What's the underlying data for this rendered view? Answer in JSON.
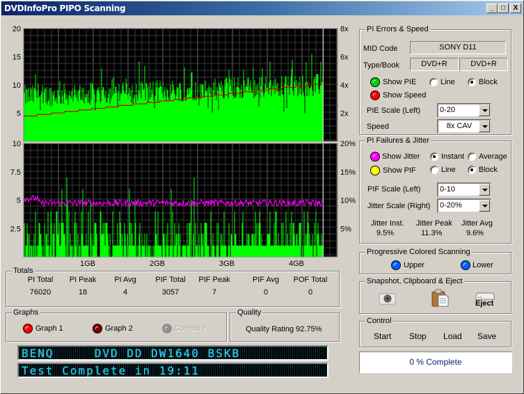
{
  "window": {
    "title": "DVDInfoPro PIPO Scanning",
    "buttons": {
      "minimize": "_",
      "maximize": "□",
      "close": "X"
    }
  },
  "chart_data": [
    {
      "type": "bar",
      "title": "PI Errors & Speed",
      "xlabel": "",
      "ylabel": "PIE",
      "x_ticks": [
        "1GB",
        "2GB",
        "3GB",
        "4GB"
      ],
      "xlim_gb": [
        0,
        4.58
      ],
      "ylim": [
        0,
        20
      ],
      "y_ticks_left": [
        "20",
        "15",
        "10",
        "5"
      ],
      "y2_ticks": [
        "8x",
        "6x",
        "4x",
        "2x"
      ],
      "y2lim": [
        0,
        8
      ],
      "grid": true,
      "scan_end_gb": 4.37,
      "series": [
        {
          "name": "PIE",
          "color": "#00ff00",
          "kind": "block",
          "typical": 9,
          "peak": 18,
          "avg": 4
        },
        {
          "name": "Speed",
          "color": "#cc0000",
          "kind": "line",
          "start": 1.8,
          "end": 4.15
        }
      ]
    },
    {
      "type": "bar",
      "title": "PI Failures & Jitter",
      "x_ticks": [
        "1GB",
        "2GB",
        "3GB",
        "4GB"
      ],
      "xlim_gb": [
        0,
        4.58
      ],
      "ylim": [
        0,
        10
      ],
      "y_ticks_left": [
        "10",
        "7.5",
        "5",
        "2.5"
      ],
      "y2_ticks": [
        "20%",
        "15%",
        "10%",
        "5%"
      ],
      "y2lim": [
        0,
        20
      ],
      "grid": true,
      "scan_end_gb": 4.37,
      "series": [
        {
          "name": "PIF",
          "color": "#00ff00",
          "kind": "block",
          "peak": 7
        },
        {
          "name": "Jitter",
          "color": "#ff00ff",
          "kind": "line",
          "avg": 9.6,
          "peak": 11.3
        }
      ]
    }
  ],
  "totals": {
    "legend": "Totals",
    "columns": [
      {
        "label": "PI Total",
        "value": "76020"
      },
      {
        "label": "PI Peak",
        "value": "18"
      },
      {
        "label": "PI Avg",
        "value": "4"
      },
      {
        "label": "PIF Total",
        "value": "3057"
      },
      {
        "label": "PIF Peak",
        "value": "7"
      },
      {
        "label": "PIF Avg",
        "value": "0"
      },
      {
        "label": "POF Total",
        "value": "0"
      }
    ]
  },
  "graphs": {
    "legend": "Graphs",
    "graph1": "Graph 1",
    "graph2": "Graph 2",
    "compare": "Compare"
  },
  "quality": {
    "legend": "Quality",
    "text": "Quality Rating 92.75%"
  },
  "lcd": {
    "line1": "BENQ     DVD DD DW1640 BSKB",
    "line2": "Test Complete in 19:11"
  },
  "pi_errors": {
    "legend": "PI Errors & Speed",
    "mid_label": "MID Code",
    "mid_value": "SONY    D11",
    "type_label": "Type/Book",
    "type_value": "DVD+R",
    "book_value": "DVD+R",
    "show_pie": "Show PIE",
    "line": "Line",
    "block": "Block",
    "show_speed": "Show Speed",
    "pie_scale_label": "PIE Scale (Left)",
    "pie_scale_value": "0-20",
    "speed_label": "Speed",
    "speed_value": "8x CAV",
    "pie_mode": "block"
  },
  "pi_failures": {
    "legend": "PI Failures & Jitter",
    "show_jitter": "Show Jitter",
    "instant": "Instant",
    "average": "Average",
    "show_pif": "Show PIF",
    "line": "Line",
    "block": "Block",
    "pif_scale_label": "PIF Scale (Left)",
    "pif_scale_value": "0-10",
    "jitter_scale_label": "Jitter Scale (Right)",
    "jitter_scale_value": "0-20%",
    "jitter_inst_label": "Jitter Inst.",
    "jitter_inst_value": "9.5%",
    "jitter_peak_label": "Jitter Peak",
    "jitter_peak_value": "11.3%",
    "jitter_avg_label": "Jitter Avg",
    "jitter_avg_value": "9.6%"
  },
  "progressive": {
    "legend": "Progressive Colored Scanning",
    "upper": "Upper",
    "lower": "Lower"
  },
  "snapshot": {
    "legend": "Snapshot,  Clipboard  & Eject",
    "eject": "Eject"
  },
  "control": {
    "legend": "Control",
    "start": "Start",
    "stop": "Stop",
    "load": "Load",
    "save": "Save"
  },
  "progress": {
    "text": "0 % Complete",
    "percent": 0
  },
  "colors": {
    "pie": "#00ff00",
    "speed": "#cc0000",
    "jitter": "#ff00ff",
    "pif_led": "#ffff00",
    "upper_led": "#0060ff",
    "lcd_text": "#2ec8e8"
  }
}
